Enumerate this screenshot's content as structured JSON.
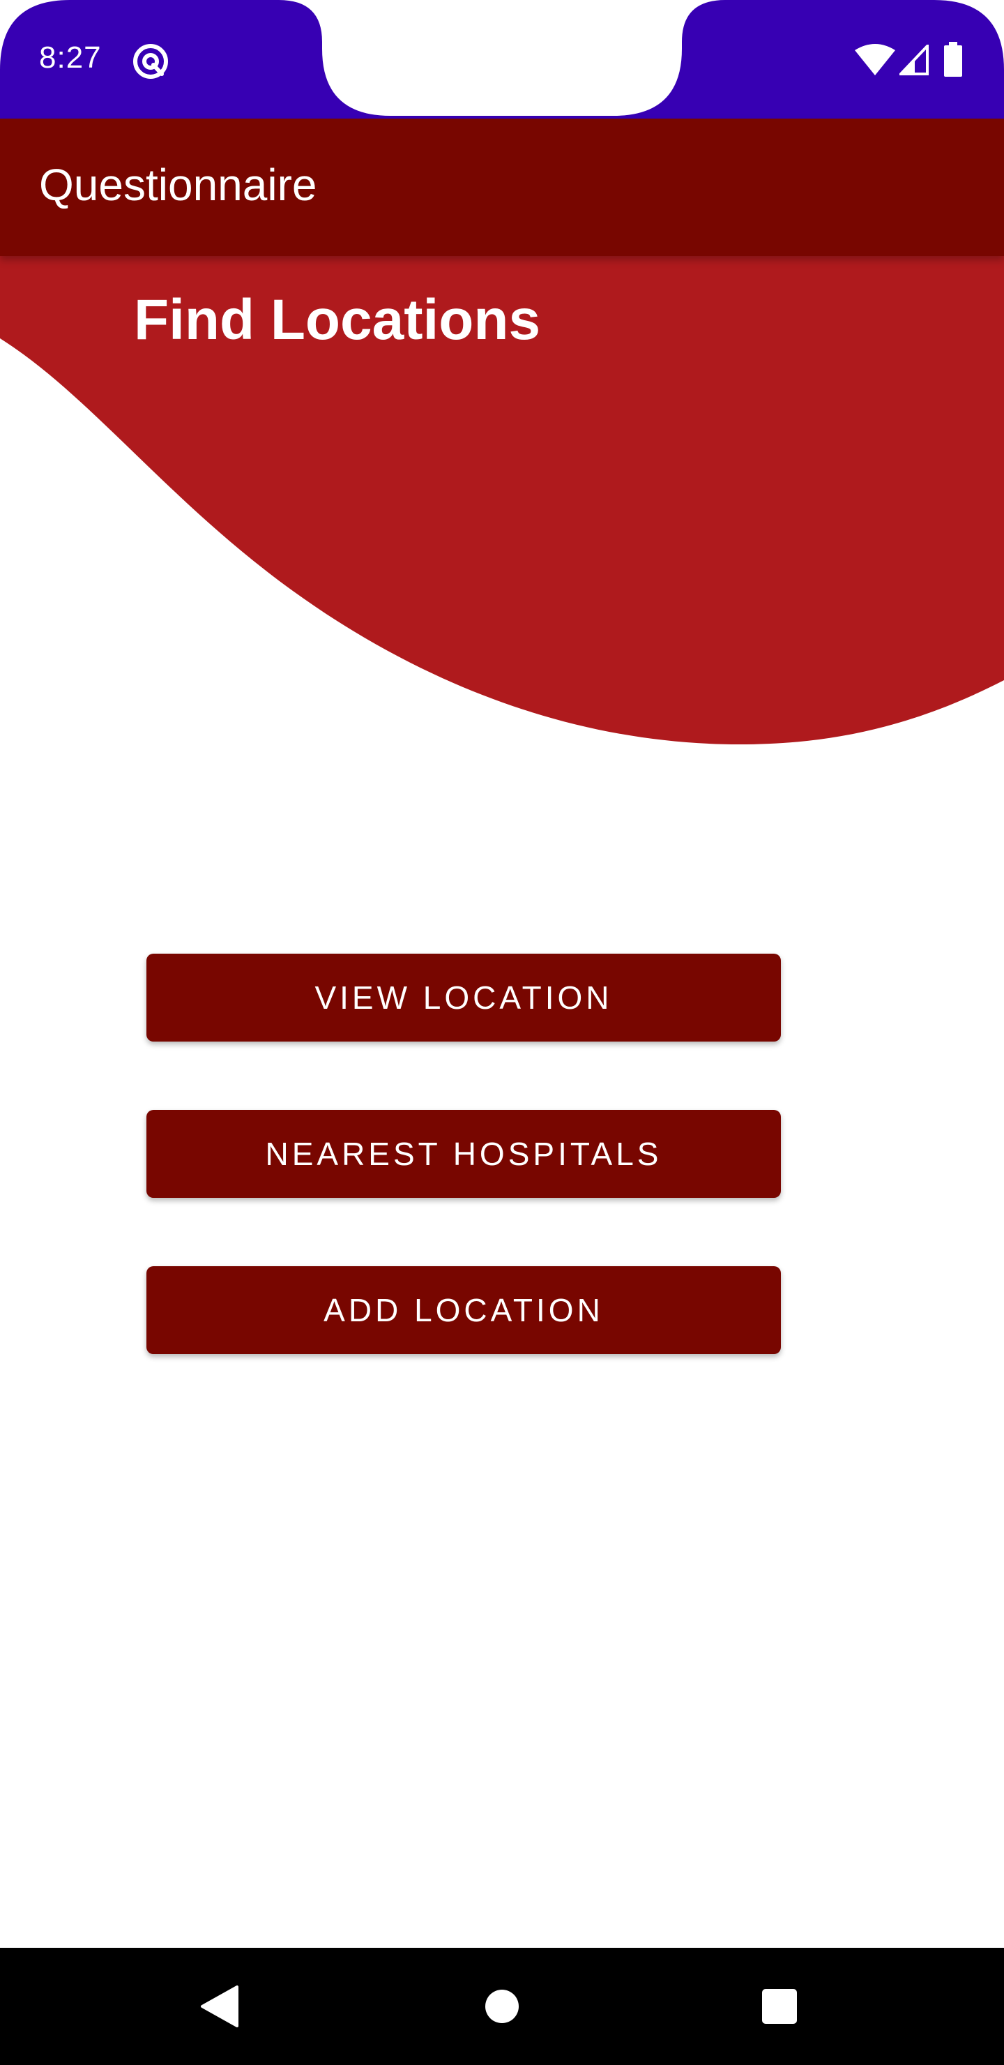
{
  "status_bar": {
    "time": "8:27",
    "color": "#3700B3",
    "icons": [
      "at-sign-icon",
      "wifi-icon",
      "signal-icon",
      "battery-icon"
    ]
  },
  "app_bar": {
    "title": "Questionnaire",
    "color": "#780600"
  },
  "header": {
    "title": "Find Locations",
    "wave_color": "#AF1A1D"
  },
  "buttons": {
    "view_location": "VIEW LOCATION",
    "nearest_hospitals": "NEAREST HOSPITALS",
    "add_location": "ADD LOCATION",
    "color": "#780600"
  },
  "nav_bar": {
    "icons": [
      "back-icon",
      "home-icon",
      "recents-icon"
    ]
  }
}
